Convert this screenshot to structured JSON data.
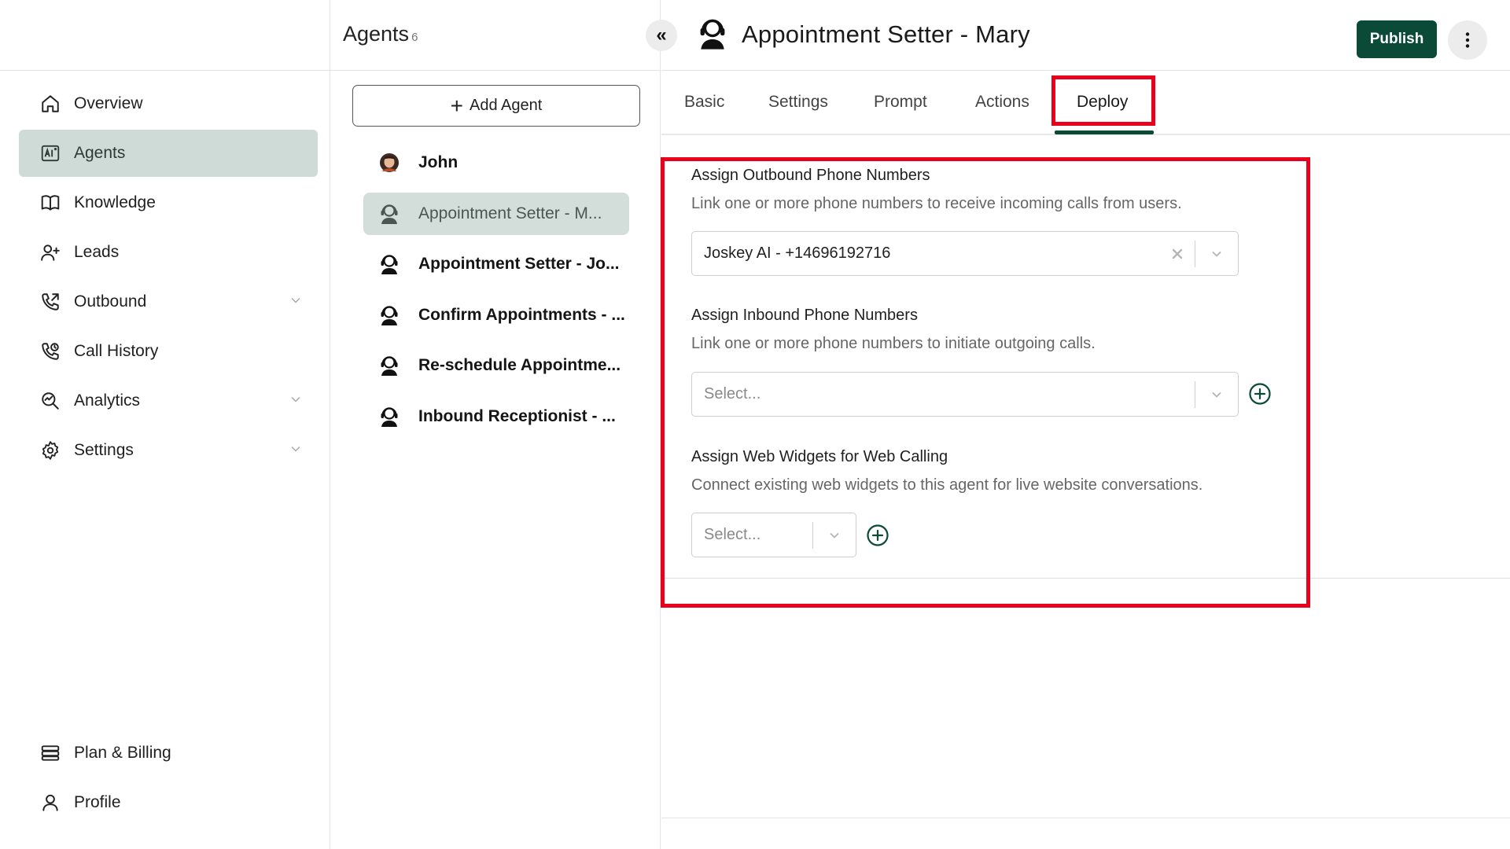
{
  "nav": {
    "items": [
      {
        "label": "Overview",
        "icon": "home-icon"
      },
      {
        "label": "Agents",
        "icon": "agents-ai-icon",
        "active": true
      },
      {
        "label": "Knowledge",
        "icon": "book-icon"
      },
      {
        "label": "Leads",
        "icon": "user-plus-icon"
      },
      {
        "label": "Outbound",
        "icon": "phone-outgoing-icon",
        "expandable": true
      },
      {
        "label": "Call History",
        "icon": "phone-history-icon"
      },
      {
        "label": "Analytics",
        "icon": "analytics-icon",
        "expandable": true
      },
      {
        "label": "Settings",
        "icon": "gear-icon",
        "expandable": true
      }
    ],
    "bottom": [
      {
        "label": "Plan & Billing",
        "icon": "billing-icon"
      },
      {
        "label": "Profile",
        "icon": "person-icon"
      }
    ]
  },
  "agents_panel": {
    "title": "Agents",
    "count": "6",
    "add_label": "Add Agent",
    "agents": [
      {
        "name": "John",
        "icon": "avatar-john"
      },
      {
        "name": "Appointment Setter - M...",
        "icon": "headset-agent-icon",
        "active": true
      },
      {
        "name": "Appointment Setter - Jo...",
        "icon": "headset-agent-icon"
      },
      {
        "name": "Confirm Appointments - ...",
        "icon": "headset-agent-icon"
      },
      {
        "name": "Re-schedule Appointme...",
        "icon": "headset-agent-icon"
      },
      {
        "name": "Inbound Receptionist - ...",
        "icon": "headset-agent-icon"
      }
    ]
  },
  "header": {
    "agent_title": "Appointment Setter - Mary",
    "publish_label": "Publish"
  },
  "tabs": [
    "Basic",
    "Settings",
    "Prompt",
    "Actions",
    "Deploy"
  ],
  "active_tab": "Deploy",
  "deploy": {
    "outbound": {
      "title": "Assign Outbound Phone Numbers",
      "description": "Link one or more phone numbers to receive incoming calls from users.",
      "value": "Joskey AI - +14696192716"
    },
    "inbound": {
      "title": "Assign Inbound Phone Numbers",
      "description": "Link one or more phone numbers to initiate outgoing calls.",
      "placeholder": "Select..."
    },
    "widgets": {
      "title": "Assign Web Widgets for Web Calling",
      "description": "Connect existing web widgets to this agent for live website conversations.",
      "placeholder": "Select..."
    }
  },
  "colors": {
    "primary": "#0a4a36",
    "active_nav_bg": "#cfdbd7",
    "highlight": "#e8001c"
  }
}
